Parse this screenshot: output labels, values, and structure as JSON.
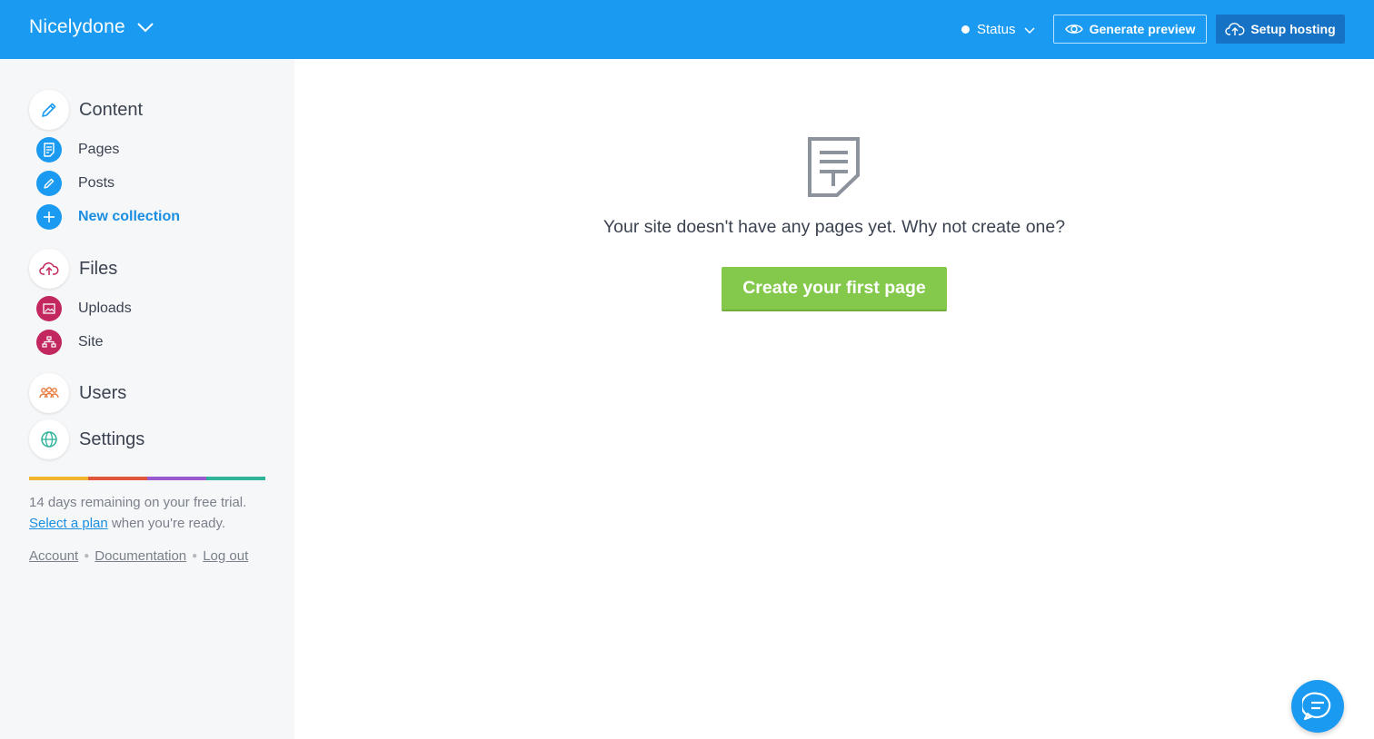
{
  "header": {
    "site_name": "Nicelydone",
    "status_label": "Status",
    "preview_label": "Generate preview",
    "hosting_label": "Setup hosting",
    "bg_color": "#1a9af0"
  },
  "sidebar": {
    "sections": [
      {
        "label": "Content",
        "icon": "pencil-icon"
      },
      {
        "label": "Files",
        "icon": "cloud-upload-icon"
      },
      {
        "label": "Users",
        "icon": "users-icon"
      },
      {
        "label": "Settings",
        "icon": "globe-icon"
      }
    ],
    "content_items": [
      {
        "label": "Pages",
        "icon": "page-icon"
      },
      {
        "label": "Posts",
        "icon": "pencil-icon"
      },
      {
        "label": "New collection",
        "icon": "plus-icon"
      }
    ],
    "files_items": [
      {
        "label": "Uploads",
        "icon": "image-icon"
      },
      {
        "label": "Site",
        "icon": "sitemap-icon"
      }
    ],
    "rainbow_colors": [
      "#f2b531",
      "#e0573e",
      "#9b59d0",
      "#2fb39a"
    ],
    "trial_text": "14 days remaining on your free trial.",
    "select_plan_link": "Select a plan",
    "trial_suffix": " when you're ready.",
    "footer_links": [
      "Account",
      "Documentation",
      "Log out"
    ]
  },
  "main": {
    "empty_message": "Your site doesn't have any pages yet. Why not create one?",
    "create_button": "Create your first page",
    "create_button_color": "#84c94c"
  }
}
